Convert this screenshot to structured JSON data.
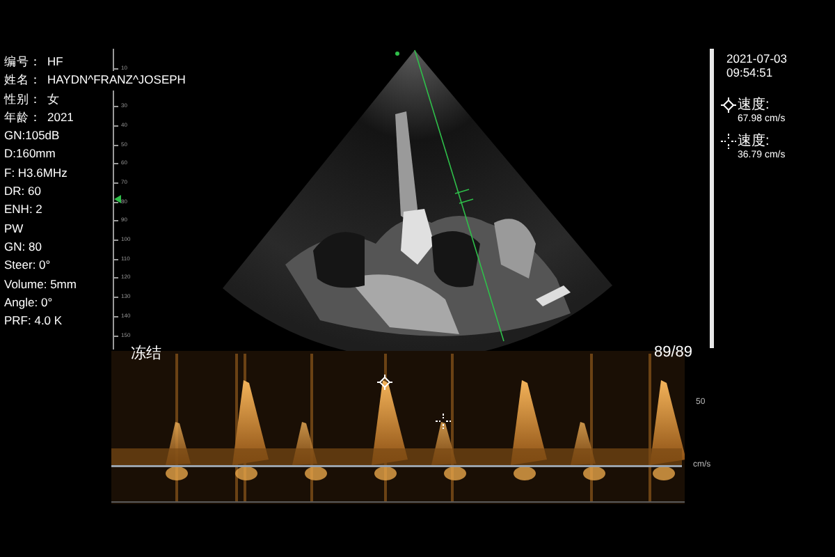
{
  "patient": [
    {
      "label": "编号：",
      "value": "HF"
    },
    {
      "label": "姓名：",
      "value": "HAYDN^FRANZ^JOSEPH"
    },
    {
      "label": "性别：",
      "value": "女"
    },
    {
      "label": "年龄：",
      "value": "2021"
    }
  ],
  "parameters": [
    "GN:105dB",
    "D:160mm",
    "F: H3.6MHz",
    "DR: 60",
    "ENH: 2",
    "PW",
    "GN: 80",
    "Steer: 0°",
    "Volume: 5mm",
    "Angle: 0°",
    "PRF: 4.0 K"
  ],
  "depth_scale": {
    "labels": [
      "10",
      "30",
      "40",
      "50",
      "60",
      "70",
      "80",
      "90",
      "100",
      "110",
      "120",
      "130",
      "140",
      "150"
    ]
  },
  "date": "2021-07-03",
  "time": "09:54:51",
  "measurements": [
    {
      "kind": "diamond",
      "label": "速度:",
      "value": "67.98 cm/s"
    },
    {
      "kind": "cross",
      "label": "速度:",
      "value": "36.79 cm/s"
    }
  ],
  "status": "冻结",
  "frame_counter": "89/89",
  "spectrum_scale": {
    "tick": "50",
    "unit": "cm/s"
  }
}
